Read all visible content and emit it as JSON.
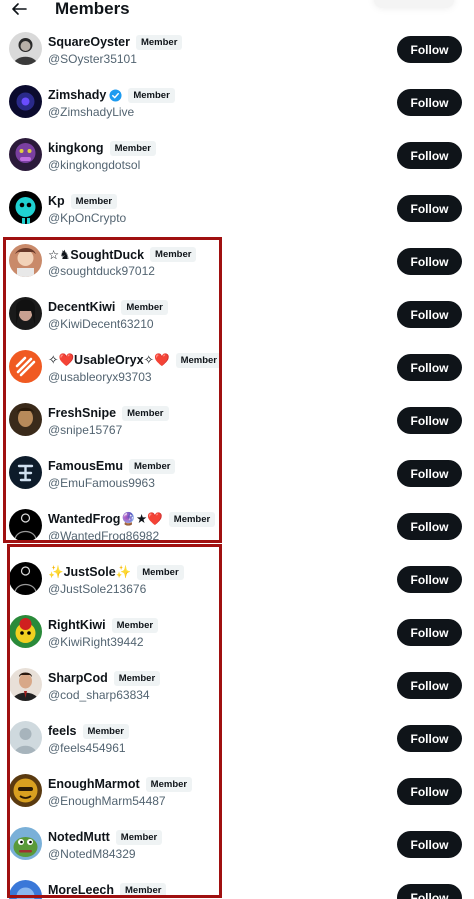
{
  "header": {
    "title": "Members"
  },
  "colors": {
    "follow_bg": "#0f1419",
    "badge_bg": "#eff3f4",
    "highlight": "#a01010",
    "verified": "#1d9bf0"
  },
  "members": [
    {
      "name": "SquareOyster",
      "badge": "Member",
      "handle": "@SOyster35101",
      "follow": "Follow",
      "avatar_icon": "portrait-avatar",
      "verified": false
    },
    {
      "name": "Zimshady",
      "badge": "Member",
      "handle": "@ZimshadyLive",
      "follow": "Follow",
      "avatar_icon": "dark-blue-avatar",
      "verified": true
    },
    {
      "name": "kingkong",
      "badge": "Member",
      "handle": "@kingkongdotsol",
      "follow": "Follow",
      "avatar_icon": "purple-ape-avatar",
      "verified": false
    },
    {
      "name": "Kp",
      "badge": "Member",
      "handle": "@KpOnCrypto",
      "follow": "Follow",
      "avatar_icon": "cyan-robot-avatar",
      "verified": false
    },
    {
      "name": "☆♞SoughtDuck",
      "badge": "Member",
      "handle": "@soughtduck97012",
      "follow": "Follow",
      "avatar_icon": "cartoon-avatar",
      "verified": false
    },
    {
      "name": "DecentKiwi",
      "badge": "Member",
      "handle": "@KiwiDecent63210",
      "follow": "Follow",
      "avatar_icon": "dark-portrait-avatar",
      "verified": false
    },
    {
      "name": "✧❤️UsableOryx✧❤️",
      "badge": "Member",
      "handle": "@usableoryx93703",
      "follow": "Follow",
      "avatar_icon": "orange-logo-avatar",
      "verified": false
    },
    {
      "name": "FreshSnipe",
      "badge": "Member",
      "handle": "@snipe15767",
      "follow": "Follow",
      "avatar_icon": "brown-portrait-avatar",
      "verified": false
    },
    {
      "name": "FamousEmu",
      "badge": "Member",
      "handle": "@EmuFamous9963",
      "follow": "Follow",
      "avatar_icon": "navy-logo-avatar",
      "verified": false
    },
    {
      "name": "WantedFrog🔮★❤️",
      "badge": "Member",
      "handle": "@WantedFrog86982",
      "follow": "Follow",
      "avatar_icon": "black-circle-avatar",
      "verified": false
    },
    {
      "name": "✨JustSole✨",
      "badge": "Member",
      "handle": "@JustSole213676",
      "follow": "Follow",
      "avatar_icon": "black-circle-avatar",
      "verified": false
    },
    {
      "name": "RightKiwi",
      "badge": "Member",
      "handle": "@KiwiRight39442",
      "follow": "Follow",
      "avatar_icon": "yellow-cartoon-avatar",
      "verified": false
    },
    {
      "name": "SharpCod",
      "badge": "Member",
      "handle": "@cod_sharp63834",
      "follow": "Follow",
      "avatar_icon": "suit-portrait-avatar",
      "verified": false
    },
    {
      "name": "feels",
      "badge": "Member",
      "handle": "@feels454961",
      "follow": "Follow",
      "avatar_icon": "default-user-avatar",
      "verified": false
    },
    {
      "name": "EnoughMarmot",
      "badge": "Member",
      "handle": "@EnoughMarm54487",
      "follow": "Follow",
      "avatar_icon": "gold-face-avatar",
      "verified": false
    },
    {
      "name": "NotedMutt",
      "badge": "Member",
      "handle": "@NotedM84329",
      "follow": "Follow",
      "avatar_icon": "pepe-avatar",
      "verified": false
    },
    {
      "name": "MoreLeech",
      "badge": "Member",
      "handle": "",
      "follow": "Follow",
      "avatar_icon": "blue-avatar",
      "verified": false
    }
  ]
}
